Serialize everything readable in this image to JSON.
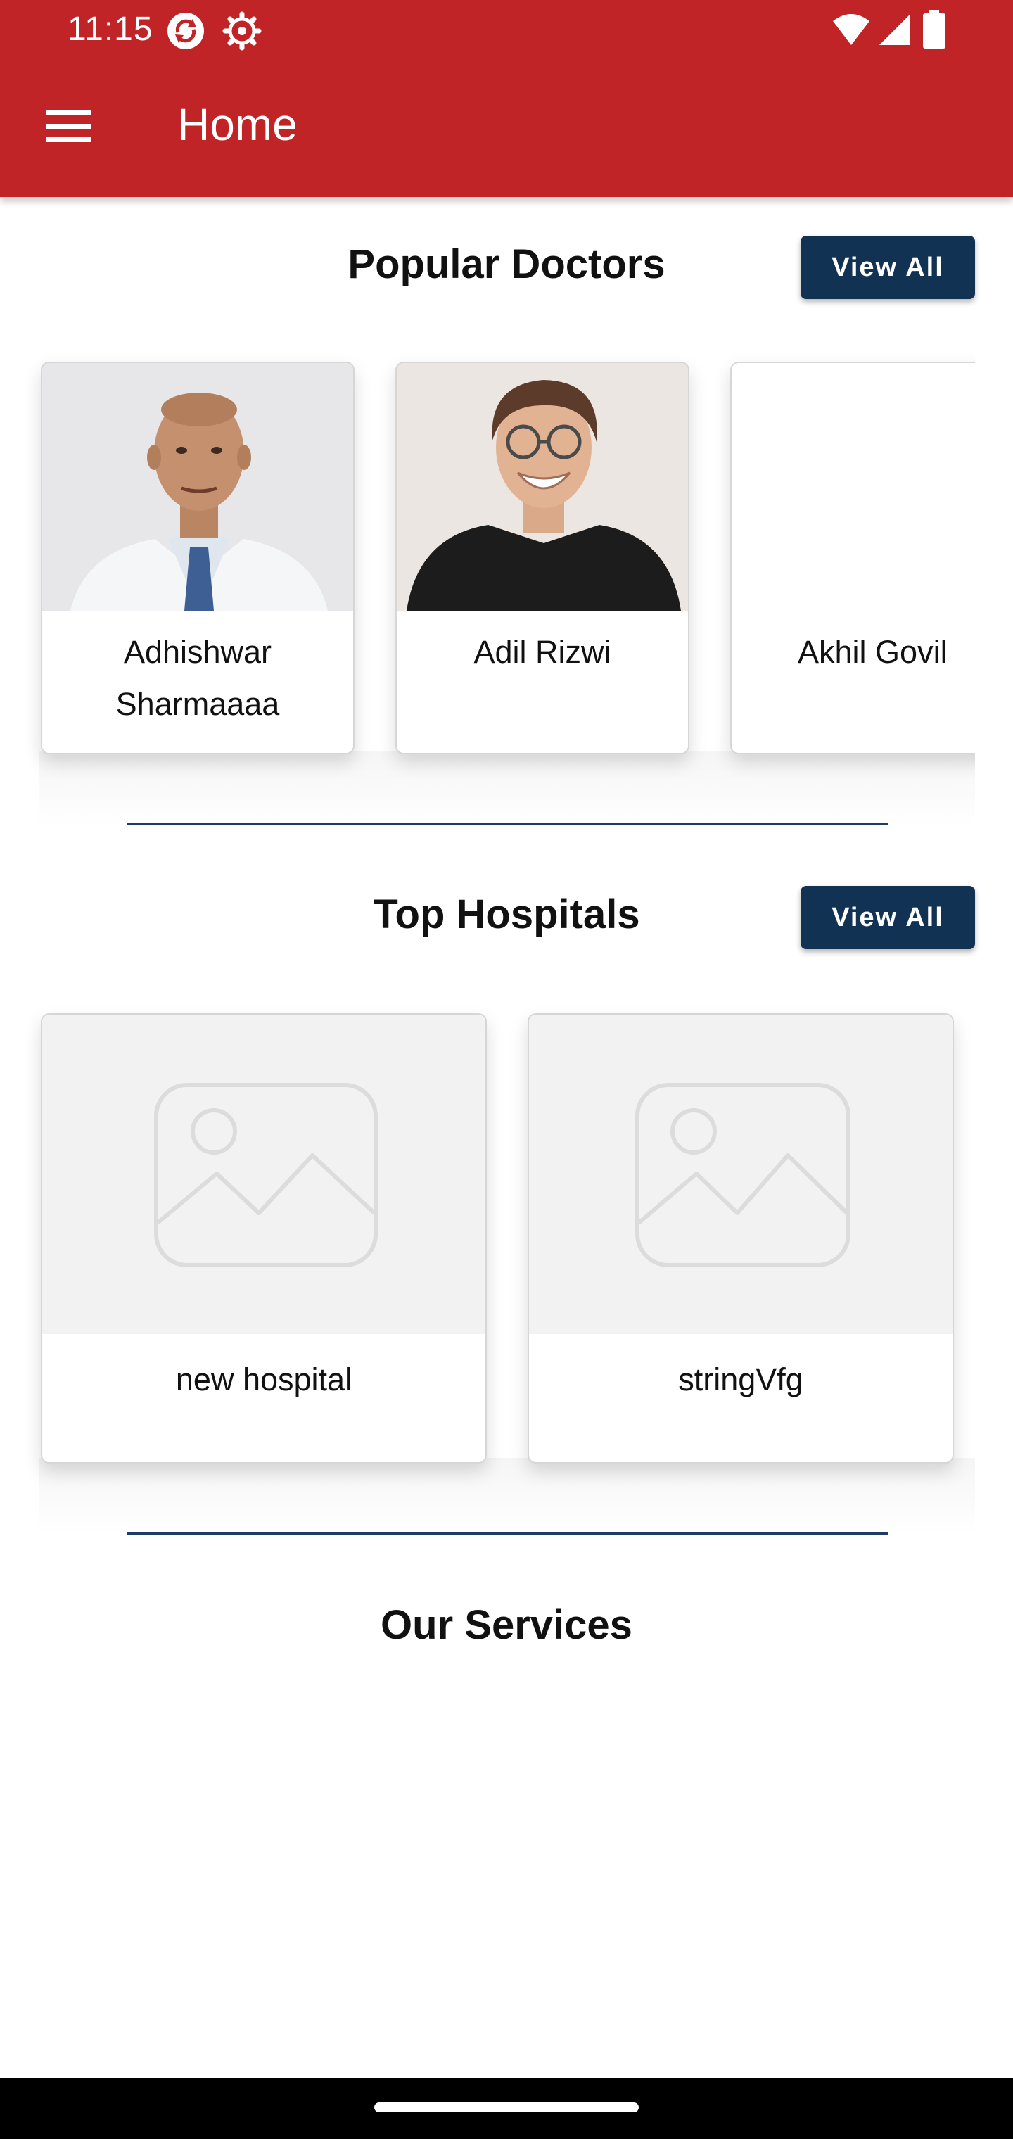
{
  "status_bar": {
    "time": "11:15",
    "left_icons": [
      "sync-icon",
      "settings-gear-icon"
    ],
    "right_icons": [
      "wifi-icon",
      "signal-icon",
      "battery-icon"
    ]
  },
  "app_bar": {
    "title": "Home",
    "menu_icon": "hamburger-menu-icon",
    "color": "#c12427"
  },
  "popular_doctors": {
    "title": "Popular Doctors",
    "view_all_label": "View All",
    "doctors": [
      {
        "name": "Adhishwar Sharmaaaa",
        "photo": "doctor-photo-bald-white-coat"
      },
      {
        "name": "Adil Rizwi",
        "photo": "doctor-photo-glasses-black-shirt"
      },
      {
        "name": "Akhil Govil",
        "photo": "none"
      }
    ]
  },
  "top_hospitals": {
    "title": "Top Hospitals",
    "view_all_label": "View All",
    "hospitals": [
      {
        "name": "new hospital",
        "photo": "image-placeholder-icon"
      },
      {
        "name": "stringVfg",
        "photo": "image-placeholder-icon"
      }
    ]
  },
  "our_services": {
    "title": "Our Services"
  },
  "colors": {
    "primary_red": "#c12427",
    "button_navy": "#123253",
    "divider_navy": "#1d3b66"
  }
}
